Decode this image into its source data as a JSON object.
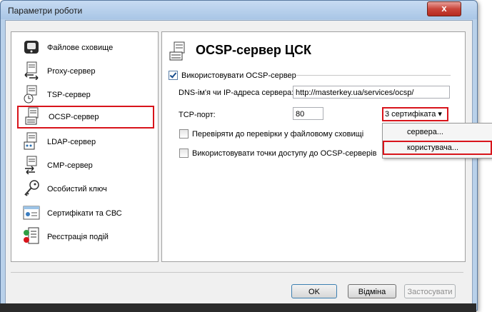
{
  "window": {
    "title": "Параметри роботи",
    "close_label": "x"
  },
  "sidebar": {
    "items": [
      {
        "label": "Файлове сховище",
        "icon": "hard-disk-icon"
      },
      {
        "label": "Proxy-сервер",
        "icon": "proxy-server-icon"
      },
      {
        "label": "TSP-сервер",
        "icon": "tsp-server-icon"
      },
      {
        "label": "OCSP-сервер",
        "icon": "ocsp-server-icon",
        "selected": true
      },
      {
        "label": "LDAP-сервер",
        "icon": "ldap-server-icon"
      },
      {
        "label": "CMP-сервер",
        "icon": "cmp-server-icon"
      },
      {
        "label": "Особистий ключ",
        "icon": "key-icon"
      },
      {
        "label": "Сертифікати та СВС",
        "icon": "certificate-icon"
      },
      {
        "label": "Реєстрація подій",
        "icon": "event-log-icon"
      }
    ]
  },
  "main": {
    "title": "OCSP-сервер ЦСК",
    "use_ocsp_label": "Використовувати OCSP-сервер",
    "use_ocsp_checked": true,
    "dns_label": "DNS-ім'я чи IP-адреса сервера:",
    "dns_value": "http://masterkey.ua/services/ocsp/",
    "tcp_label": "TCP-порт:",
    "tcp_value": "80",
    "cert_dropdown_label": "3 сертифіката ▾",
    "verify_label": "Перевіряти до перевірки у файловому сховищі",
    "verify_checked": false,
    "access_points_label": "Використовувати точки доступу до OCSP-серверів",
    "access_points_checked": false
  },
  "menu": {
    "items": [
      {
        "label": "сервера..."
      },
      {
        "label": "користувача...",
        "highlighted": true
      }
    ]
  },
  "buttons": {
    "ok": "OK",
    "cancel": "Відміна",
    "apply": "Застосувати"
  },
  "colors": {
    "highlight_border": "#d8141b",
    "window_frame": "#b9d1ea"
  }
}
